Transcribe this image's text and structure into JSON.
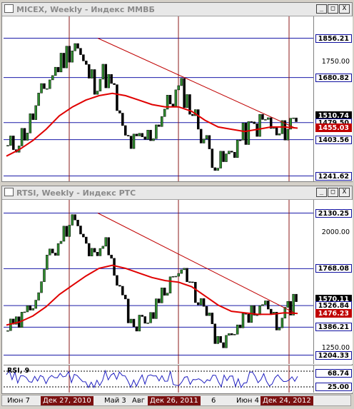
{
  "windows": [
    {
      "id": "micex",
      "title": "MICEX, Weekly - Индекс ММВБ",
      "buttons": {
        "minimize": "_",
        "maximize": "□",
        "close": "X"
      },
      "price_labels": [
        {
          "text": "1856.21",
          "style": "boxed",
          "value": 1856.21
        },
        {
          "text": "1750.00",
          "style": "plain",
          "value": 1750.0
        },
        {
          "text": "1680.82",
          "style": "boxed",
          "value": 1680.82
        },
        {
          "text": "1510.74",
          "style": "cur",
          "value": 1510.74
        },
        {
          "text": "1479.50",
          "style": "boxed",
          "value": 1479.5
        },
        {
          "text": "1455.03",
          "style": "ma",
          "value": 1455.03
        },
        {
          "text": "1403.56",
          "style": "boxed",
          "value": 1403.56
        },
        {
          "text": "1241.62",
          "style": "boxed",
          "value": 1241.62
        }
      ]
    },
    {
      "id": "rtsi",
      "title": "RTSI, Weekly - Индекс РТС",
      "buttons": {
        "minimize": "_",
        "maximize": "□",
        "close": "X"
      },
      "price_labels": [
        {
          "text": "2130.25",
          "style": "boxed",
          "value": 2130.25
        },
        {
          "text": "2000.00",
          "style": "plain",
          "value": 2000.0
        },
        {
          "text": "1768.08",
          "style": "boxed",
          "value": 1768.08
        },
        {
          "text": "1570.11",
          "style": "cur",
          "value": 1570.11
        },
        {
          "text": "1526.84",
          "style": "boxed",
          "value": 1526.84
        },
        {
          "text": "1476.23",
          "style": "ma",
          "value": 1476.23
        },
        {
          "text": "1386.21",
          "style": "boxed",
          "value": 1386.21
        },
        {
          "text": "1250.00",
          "style": "plain",
          "value": 1250.0
        },
        {
          "text": "1204.33",
          "style": "boxed",
          "value": 1204.33
        }
      ],
      "rsi": {
        "label": "RSI, 9",
        "value_label": "68.74",
        "level_label": "25.00"
      }
    }
  ],
  "date_axis": [
    {
      "text": "Июн 7",
      "highlight": false
    },
    {
      "text": "Дек 27, 2010",
      "highlight": true
    },
    {
      "text": "Май 3",
      "highlight": false
    },
    {
      "text": "Авг",
      "highlight": false
    },
    {
      "text": "Дек 26, 2011",
      "highlight": true
    },
    {
      "text": "6",
      "highlight": false
    },
    {
      "text": "Июн 4",
      "highlight": false
    },
    {
      "text": "Дек 24, 2012",
      "highlight": true
    }
  ],
  "colors": {
    "bull": "#2e8b2e",
    "bear": "#000000",
    "ma": "#e00000",
    "trendline": "#c00000",
    "hline": "#1a1aa8",
    "vline": "#8b1a1a",
    "rsi": "#2020c0"
  }
}
